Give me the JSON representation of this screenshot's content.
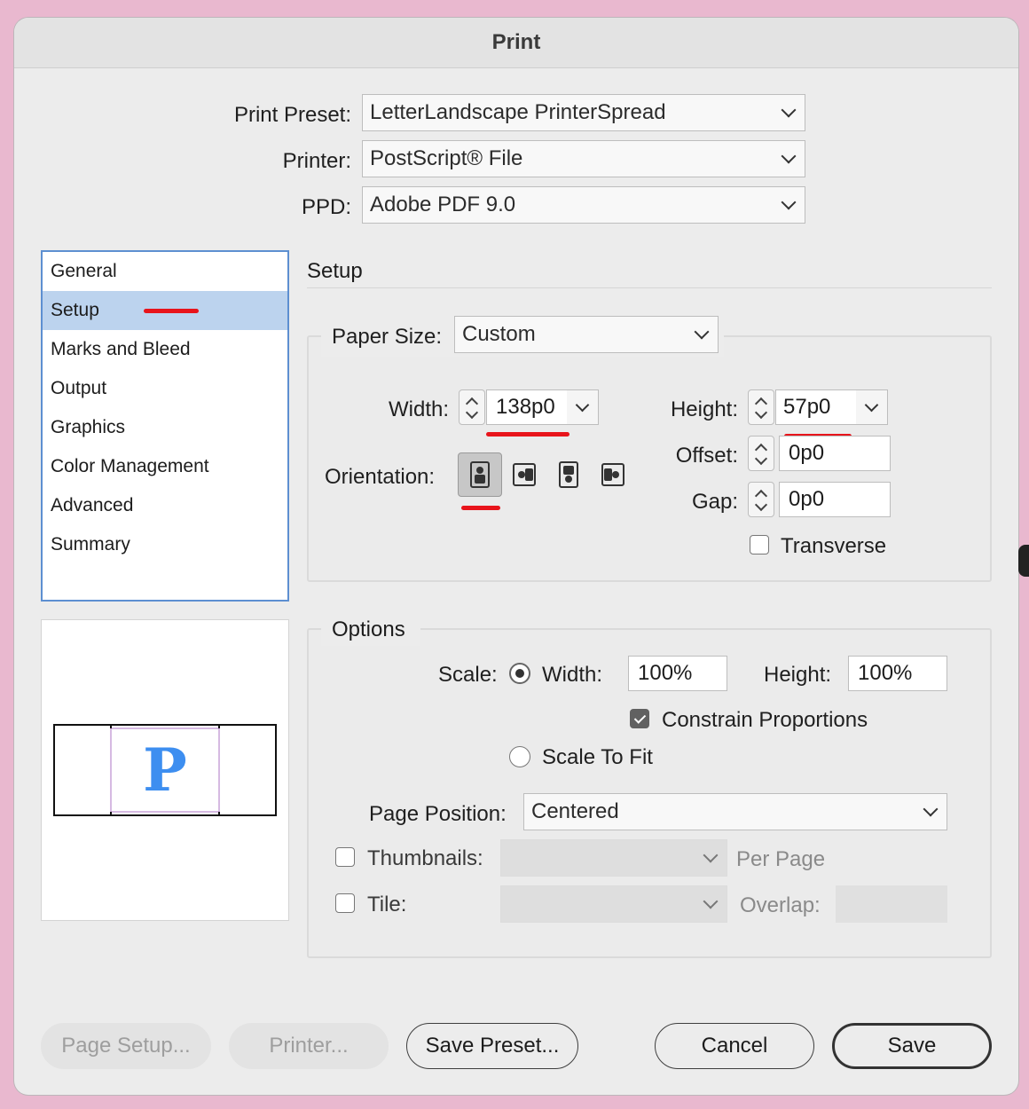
{
  "window": {
    "title": "Print"
  },
  "header": {
    "print_preset_label": "Print Preset:",
    "print_preset_value": "LetterLandscape PrinterSpread",
    "printer_label": "Printer:",
    "printer_value": "PostScript® File",
    "ppd_label": "PPD:",
    "ppd_value": "Adobe PDF 9.0"
  },
  "sidebar": {
    "items": [
      {
        "label": "General"
      },
      {
        "label": "Setup",
        "selected": true
      },
      {
        "label": "Marks and Bleed"
      },
      {
        "label": "Output"
      },
      {
        "label": "Graphics"
      },
      {
        "label": "Color Management"
      },
      {
        "label": "Advanced"
      },
      {
        "label": "Summary"
      }
    ]
  },
  "preview": {
    "letter": "P"
  },
  "setup": {
    "heading": "Setup",
    "paper_size_label": "Paper Size:",
    "paper_size_value": "Custom",
    "width_label": "Width:",
    "width_value": "138p0",
    "height_label": "Height:",
    "height_value": "57p0",
    "offset_label": "Offset:",
    "offset_value": "0p0",
    "gap_label": "Gap:",
    "gap_value": "0p0",
    "orientation_label": "Orientation:",
    "orientation_options": [
      "portrait",
      "landscape",
      "reverse-portrait",
      "reverse-landscape"
    ],
    "orientation_selected": "portrait",
    "transverse_label": "Transverse",
    "transverse_checked": false
  },
  "options": {
    "heading": "Options",
    "scale_label": "Scale:",
    "scale_width_label": "Width:",
    "scale_width_value": "100%",
    "scale_height_label": "Height:",
    "scale_height_value": "100%",
    "scale_mode": "width",
    "constrain_label": "Constrain Proportions",
    "constrain_checked": true,
    "scale_to_fit_label": "Scale To Fit",
    "page_position_label": "Page Position:",
    "page_position_value": "Centered",
    "thumbnails_label": "Thumbnails:",
    "thumbnails_checked": false,
    "per_page_label": "Per Page",
    "tile_label": "Tile:",
    "tile_checked": false,
    "overlap_label": "Overlap:"
  },
  "buttons": {
    "page_setup": "Page Setup...",
    "printer": "Printer...",
    "save_preset": "Save Preset...",
    "cancel": "Cancel",
    "save": "Save"
  },
  "colors": {
    "background": "#e9b8cf",
    "selection": "#bcd3ee",
    "list_border": "#5d8fd1",
    "annotation_red": "#e8141b",
    "preview_letter": "#3d8ef0"
  }
}
